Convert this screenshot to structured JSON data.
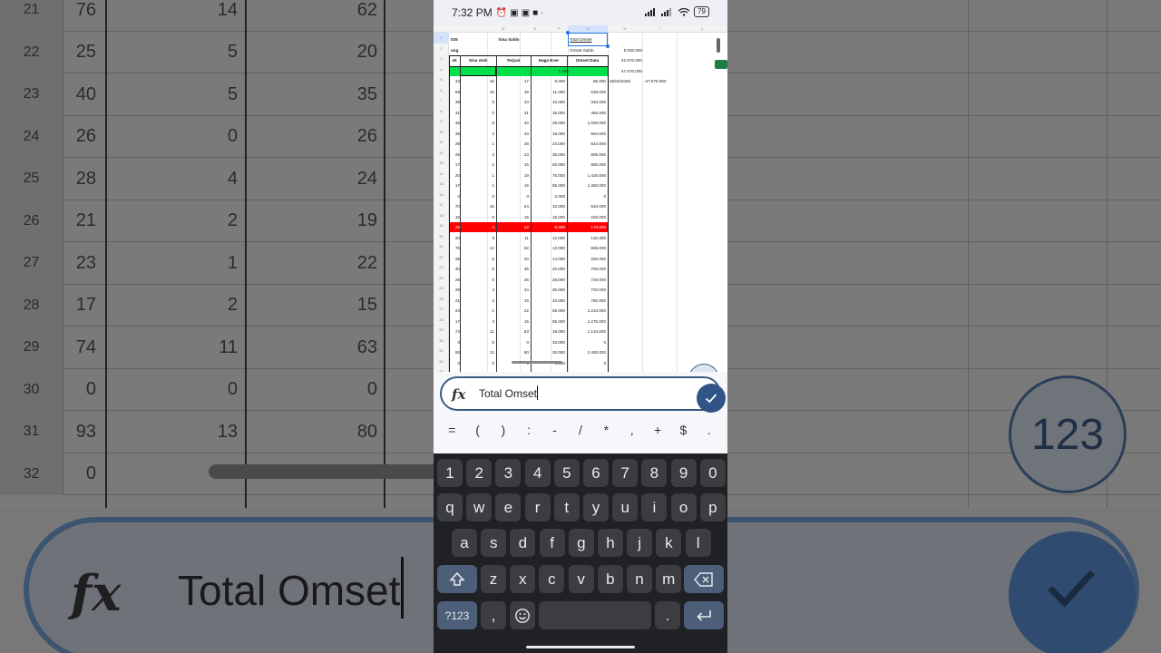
{
  "status": {
    "time": "7:32 PM",
    "battery": "79"
  },
  "sheet": {
    "col_letters": [
      "D",
      "E",
      "F",
      "G",
      "H",
      "I",
      "J"
    ],
    "title_cells": {
      "year_frag": "025",
      "sisa_saldo": "Sisa Saldo",
      "total_omset": "Total Omset"
    },
    "row2": {
      "frag": "ung",
      "omset_saldo": "Omset Saldo",
      "val": "5.000.000"
    },
    "headers": [
      "Sisa stok",
      "Terjual",
      "Haga Ecer",
      "Omset Data"
    ],
    "header_frag": "ok",
    "side_values": [
      "42.670.000",
      "47.670.000"
    ],
    "side_row5": {
      "date": "25/02/2025",
      "value": "-47.670.000"
    },
    "rows": [
      [
        "33",
        "16",
        "17",
        "5.000",
        "85.000"
      ],
      [
        "59",
        "10",
        "49",
        "11.000",
        "539.000"
      ],
      [
        "39",
        "5",
        "34",
        "10.000",
        "340.000"
      ],
      [
        "31",
        "0",
        "31",
        "15.000",
        "465.000"
      ],
      [
        "46",
        "6",
        "40",
        "25.000",
        "1.000.000"
      ],
      [
        "35",
        "2",
        "33",
        "18.000",
        "594.000"
      ],
      [
        "29",
        "1",
        "28",
        "23.000",
        "644.000"
      ],
      [
        "25",
        "2",
        "23",
        "35.000",
        "805.000"
      ],
      [
        "17",
        "1",
        "16",
        "50.000",
        "800.000"
      ],
      [
        "20",
        "1",
        "19",
        "75.000",
        "1.425.000"
      ],
      [
        "17",
        "1",
        "16",
        "85.000",
        "1.360.000"
      ],
      [
        "0",
        "0",
        "0",
        "2.000",
        "0"
      ],
      [
        "70",
        "16",
        "54",
        "10.000",
        "540.000"
      ],
      [
        "15",
        "0",
        "15",
        "15.000",
        "225.000"
      ],
      [
        "26",
        "4",
        "22",
        "8.000",
        "176.000"
      ],
      [
        "20",
        "9",
        "11",
        "12.000",
        "132.000"
      ],
      [
        "76",
        "14",
        "62",
        "13.000",
        "806.000"
      ],
      [
        "25",
        "5",
        "20",
        "14.000",
        "280.000"
      ],
      [
        "40",
        "5",
        "35",
        "20.000",
        "700.000"
      ],
      [
        "26",
        "0",
        "26",
        "28.000",
        "728.000"
      ],
      [
        "28",
        "4",
        "24",
        "30.000",
        "720.000"
      ],
      [
        "21",
        "2",
        "19",
        "40.000",
        "760.000"
      ],
      [
        "23",
        "1",
        "22",
        "55.000",
        "1.210.000"
      ],
      [
        "17",
        "2",
        "15",
        "85.000",
        "1.275.000"
      ],
      [
        "74",
        "11",
        "63",
        "18.000",
        "1.134.000"
      ],
      [
        "0",
        "0",
        "0",
        "33.000",
        "0"
      ],
      [
        "93",
        "13",
        "80",
        "30.000",
        "2.400.000"
      ],
      [
        "0",
        "0",
        "0",
        "8.000",
        "0"
      ]
    ],
    "green_row_val": "1.000",
    "fab_label": "123",
    "colors": {
      "green": "#00e04a",
      "red": "#ff0000",
      "selection": "#1a73e8"
    }
  },
  "background": {
    "rows": [
      {
        "num": "21",
        "a": "76",
        "b": "14",
        "c": "62"
      },
      {
        "num": "22",
        "a": "25",
        "b": "5",
        "c": "20"
      },
      {
        "num": "23",
        "a": "40",
        "b": "5",
        "c": "35"
      },
      {
        "num": "24",
        "a": "26",
        "b": "0",
        "c": "26"
      },
      {
        "num": "25",
        "a": "28",
        "b": "4",
        "c": "24"
      },
      {
        "num": "26",
        "a": "21",
        "b": "2",
        "c": "19"
      },
      {
        "num": "27",
        "a": "23",
        "b": "1",
        "c": "22"
      },
      {
        "num": "28",
        "a": "17",
        "b": "2",
        "c": "15"
      },
      {
        "num": "29",
        "a": "74",
        "b": "11",
        "c": "63"
      },
      {
        "num": "30",
        "a": "0",
        "b": "0",
        "c": "0"
      },
      {
        "num": "31",
        "a": "93",
        "b": "13",
        "c": "80"
      },
      {
        "num": "32",
        "a": "0",
        "b": "0",
        "c": "0"
      }
    ],
    "formula_text": "Total Omset",
    "fab_label": "123"
  },
  "formula": {
    "text": "Total Omset",
    "fx": "fx"
  },
  "symbols": [
    "=",
    "(",
    ")",
    ":",
    "-",
    "/",
    "*",
    ",",
    "+",
    "$",
    "."
  ],
  "keyboard": {
    "row_numbers": [
      "1",
      "2",
      "3",
      "4",
      "5",
      "6",
      "7",
      "8",
      "9",
      "0"
    ],
    "row_q": [
      "q",
      "w",
      "e",
      "r",
      "t",
      "y",
      "u",
      "i",
      "o",
      "p"
    ],
    "row_a": [
      "a",
      "s",
      "d",
      "f",
      "g",
      "h",
      "j",
      "k",
      "l"
    ],
    "row_z": [
      "z",
      "x",
      "c",
      "v",
      "b",
      "n",
      "m"
    ],
    "sym_key": "?123",
    "comma": ",",
    "period": "."
  }
}
